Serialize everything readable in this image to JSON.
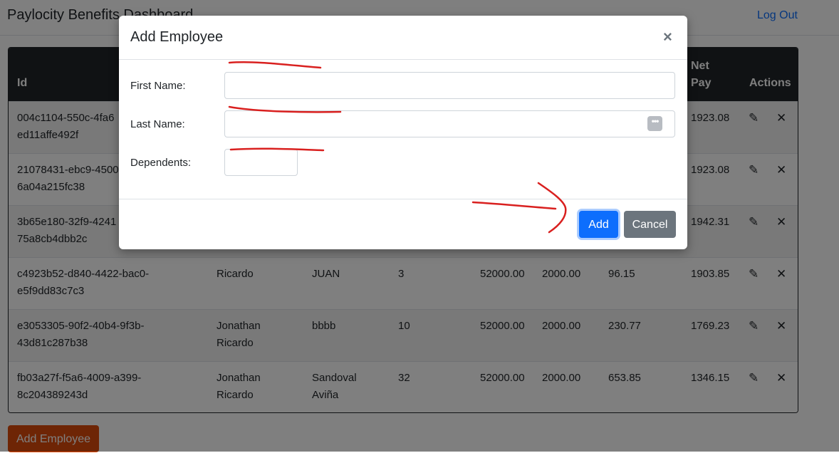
{
  "app": {
    "title": "Paylocity Benefits Dashboard",
    "logout_label": "Log Out"
  },
  "table": {
    "headers": [
      "Id",
      "Net Pay",
      "Actions"
    ],
    "rows": [
      {
        "id_line1": "004c1104-550c-4fa6",
        "id_line2": "ed11affe492f",
        "first": "",
        "first2": "",
        "last": "",
        "last2": "",
        "dependents": "",
        "salary": "",
        "gross": "",
        "benefits": "",
        "net": "1923.08"
      },
      {
        "id_line1": "21078431-ebc9-4500",
        "id_line2": "6a04a215fc38",
        "first": "",
        "first2": "",
        "last": "",
        "last2": "",
        "dependents": "",
        "salary": "",
        "gross": "",
        "benefits": "",
        "net": "1923.08"
      },
      {
        "id_line1": "3b65e180-32f9-4241",
        "id_line2": "75a8cb4dbb2c",
        "first": "",
        "first2": "",
        "last": "",
        "last2": "",
        "dependents": "",
        "salary": "",
        "gross": "",
        "benefits": "",
        "net": "1942.31"
      },
      {
        "id_line1": "c4923b52-d840-4422-bac0-",
        "id_line2": "e5f9dd83c7c3",
        "first": "Ricardo",
        "first2": "",
        "last": "JUAN",
        "last2": "",
        "dependents": "3",
        "salary": "52000.00",
        "gross": "2000.00",
        "benefits": "96.15",
        "net": "1903.85"
      },
      {
        "id_line1": "e3053305-90f2-40b4-9f3b-",
        "id_line2": "43d81c287b38",
        "first": "Jonathan",
        "first2": "Ricardo",
        "last": "bbbb",
        "last2": "",
        "dependents": "10",
        "salary": "52000.00",
        "gross": "2000.00",
        "benefits": "230.77",
        "net": "1769.23"
      },
      {
        "id_line1": "fb03a27f-f5a6-4009-a399-",
        "id_line2": "8c204389243d",
        "first": "Jonathan",
        "first2": "Ricardo",
        "last": "Sandoval",
        "last2": "Aviña",
        "dependents": "32",
        "salary": "52000.00",
        "gross": "2000.00",
        "benefits": "653.85",
        "net": "1346.15"
      }
    ],
    "edit_icon": "✎",
    "delete_icon": "✕"
  },
  "add_employee_button": "Add Employee",
  "modal": {
    "title": "Add Employee",
    "close_icon": "×",
    "first_name_label": "First Name:",
    "first_name_value": "",
    "last_name_label": "Last Name:",
    "last_name_value": "",
    "dependents_label": "Dependents:",
    "dependents_value": "",
    "password_manager_icon": "•••",
    "add_label": "Add",
    "cancel_label": "Cancel"
  },
  "colors": {
    "primary": "#0d6efd",
    "secondary": "#6c757d",
    "danger": "#dc4a0a",
    "header_dark": "#212529",
    "annotation": "#d9201f"
  }
}
